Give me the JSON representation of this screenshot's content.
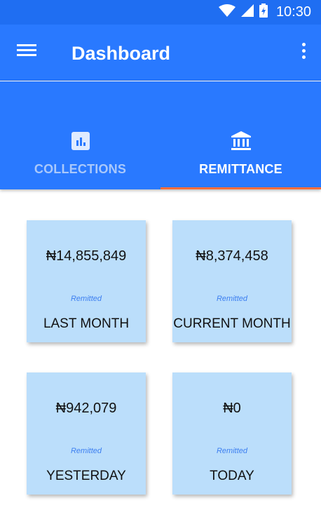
{
  "status_bar": {
    "time": "10:30",
    "icons": [
      "wifi-icon",
      "signal-icon",
      "battery-icon"
    ]
  },
  "app_bar": {
    "title": "Dashboard",
    "menu_icon": "hamburger-menu-icon",
    "overflow_icon": "more-vert-icon"
  },
  "tabs": [
    {
      "label": "COLLECTIONS",
      "icon": "bar-chart-icon",
      "active": false
    },
    {
      "label": "REMITTANCE",
      "icon": "bank-icon",
      "active": true
    }
  ],
  "cards": [
    {
      "amount": "₦14,855,849",
      "note": "Remitted",
      "period": "LAST MONTH"
    },
    {
      "amount": "₦8,374,458",
      "note": "Remitted",
      "period": "CURRENT MONTH"
    },
    {
      "amount": "₦942,079",
      "note": "Remitted",
      "period": "YESTERDAY"
    },
    {
      "amount": "₦0",
      "note": "Remitted",
      "period": "TODAY"
    }
  ],
  "colors": {
    "status_bar": "#1f6ef2",
    "primary": "#2979ff",
    "tab_indicator": "#ff6d3a",
    "card_background": "#bbdefb",
    "note_text": "#3d7ff0"
  }
}
